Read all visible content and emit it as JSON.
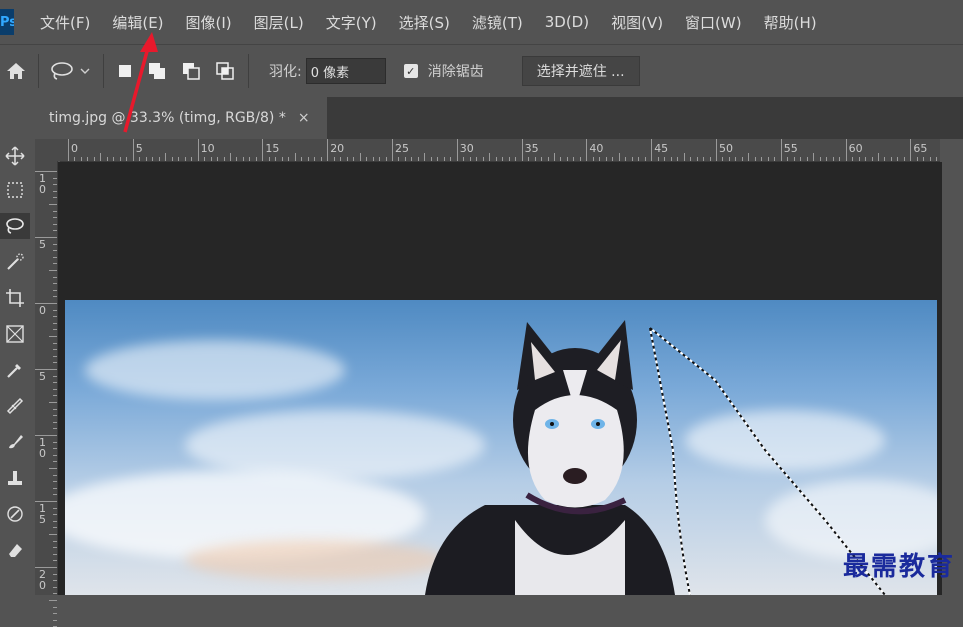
{
  "menubar": {
    "items": [
      "文件(F)",
      "编辑(E)",
      "图像(I)",
      "图层(L)",
      "文字(Y)",
      "选择(S)",
      "滤镜(T)",
      "3D(D)",
      "视图(V)",
      "窗口(W)",
      "帮助(H)"
    ]
  },
  "options": {
    "feather_label": "羽化:",
    "feather_value": "0 像素",
    "antialias_label": "消除锯齿",
    "antialias_checked": true,
    "select_mask_button": "选择并遮住 ..."
  },
  "document": {
    "tab_label": "timg.jpg @ 33.3% (timg, RGB/8) *",
    "close": "×"
  },
  "ruler": {
    "h_labels": [
      "0",
      "5",
      "10",
      "15",
      "20",
      "25",
      "30",
      "35",
      "40",
      "45",
      "50",
      "55",
      "60",
      "65"
    ],
    "v_labels": [
      "1\n0",
      "5",
      "0",
      "5",
      "1\n0",
      "1\n5",
      "2\n0"
    ]
  },
  "watermark": "最需教育",
  "colors": {
    "ui_bg": "#535353",
    "canvas_bg": "#262626",
    "annotation_arrow": "#e8192c",
    "watermark": "#1a2a9c"
  }
}
